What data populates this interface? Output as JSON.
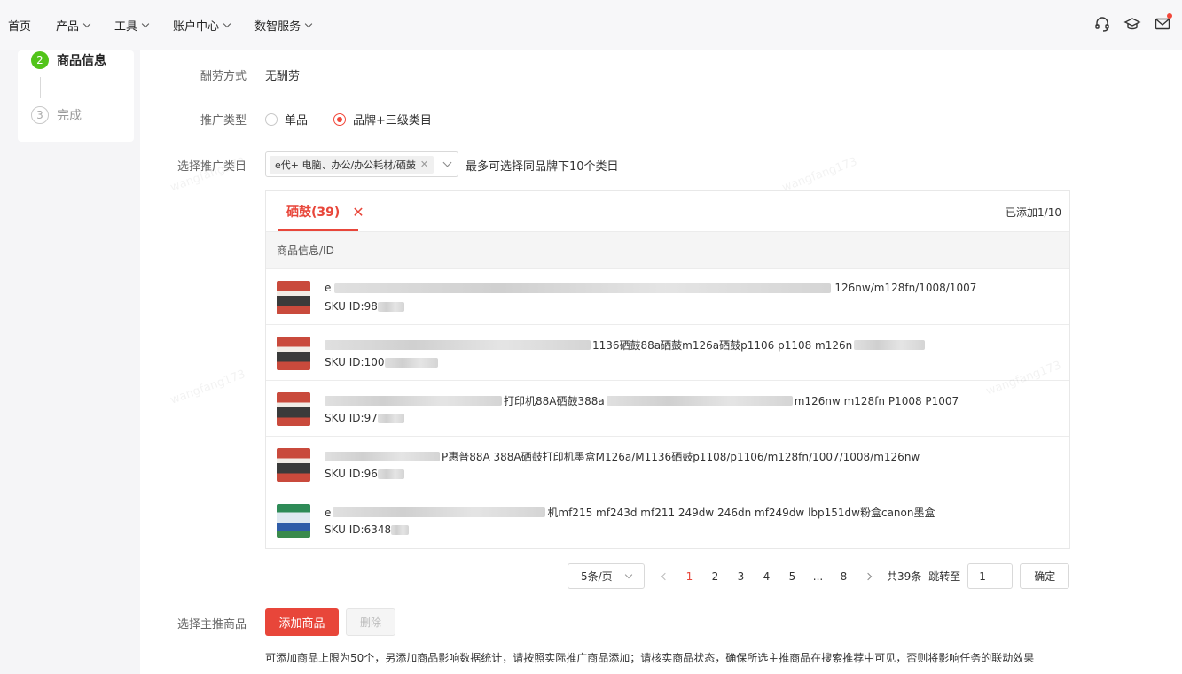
{
  "nav": {
    "items": [
      {
        "label": "首页",
        "has_dropdown": false
      },
      {
        "label": "产品",
        "has_dropdown": true
      },
      {
        "label": "工具",
        "has_dropdown": true
      },
      {
        "label": "账户中心",
        "has_dropdown": true
      },
      {
        "label": "数智服务",
        "has_dropdown": true
      }
    ],
    "icons": [
      "headset-icon",
      "graduation-cap-icon",
      "mail-icon"
    ]
  },
  "steps": [
    {
      "num": "2",
      "label": "商品信息",
      "state": "active"
    },
    {
      "num": "3",
      "label": "完成",
      "state": "pending"
    }
  ],
  "form": {
    "reward_label": "酬劳方式",
    "reward_value": "无酬劳",
    "promo_type_label": "推广类型",
    "promo_type_options": [
      {
        "label": "单品",
        "checked": false
      },
      {
        "label": "品牌+三级类目",
        "checked": true
      }
    ],
    "category_label": "选择推广类目",
    "category_tag": "e代+ 电脑、办公/办公耗材/硒鼓",
    "category_hint": "最多可选择同品牌下10个类目",
    "main_product_label": "选择主推商品",
    "add_button": "添加商品",
    "delete_button": "删除",
    "note": "可添加商品上限为50个，另添加商品影响数据统计，请按照实际推广商品添加；请核实商品状态，确保所选主推商品在搜索推荐中可见，否则将影响任务的联动效果"
  },
  "category_panel": {
    "tab_label": "硒鼓(39)",
    "added_count": "已添加1/10",
    "column_header": "商品信息/ID",
    "products": [
      {
        "title_visible": "e",
        "title_suffix": "126nw/m128fn/1008/1007",
        "sku_prefix": "SKU ID:98",
        "thumb": "red"
      },
      {
        "title_visible": "",
        "title_suffix": "1136硒鼓88a硒鼓m126a硒鼓p1106 p1108 m126n",
        "sku_prefix": "SKU ID:100",
        "thumb": "red"
      },
      {
        "title_visible": "",
        "title_suffix": "打印机88A硒鼓388a",
        "title_suffix2": "m126nw m128fn P1008 P1007",
        "sku_prefix": "SKU ID:97",
        "thumb": "red"
      },
      {
        "title_visible": "",
        "title_suffix": "P惠普88A 388A硒鼓打印机墨盒M126a/M1136硒鼓p1108/p1106/m128fn/1007/1008/m126nw",
        "sku_prefix": "SKU ID:96",
        "thumb": "red"
      },
      {
        "title_visible": "e",
        "title_suffix": "机mf215 mf243d mf211 249dw 246dn mf249dw lbp151dw粉盒canon墨盒",
        "sku_prefix": "SKU ID:6348",
        "thumb": "blue"
      }
    ]
  },
  "pagination": {
    "page_size": "5条/页",
    "pages": [
      "1",
      "2",
      "3",
      "4",
      "5",
      "...",
      "8"
    ],
    "current": "1",
    "total": "共39条",
    "jump_label": "跳转至",
    "jump_value": "1",
    "confirm": "确定"
  },
  "watermark": "wangfang173"
}
